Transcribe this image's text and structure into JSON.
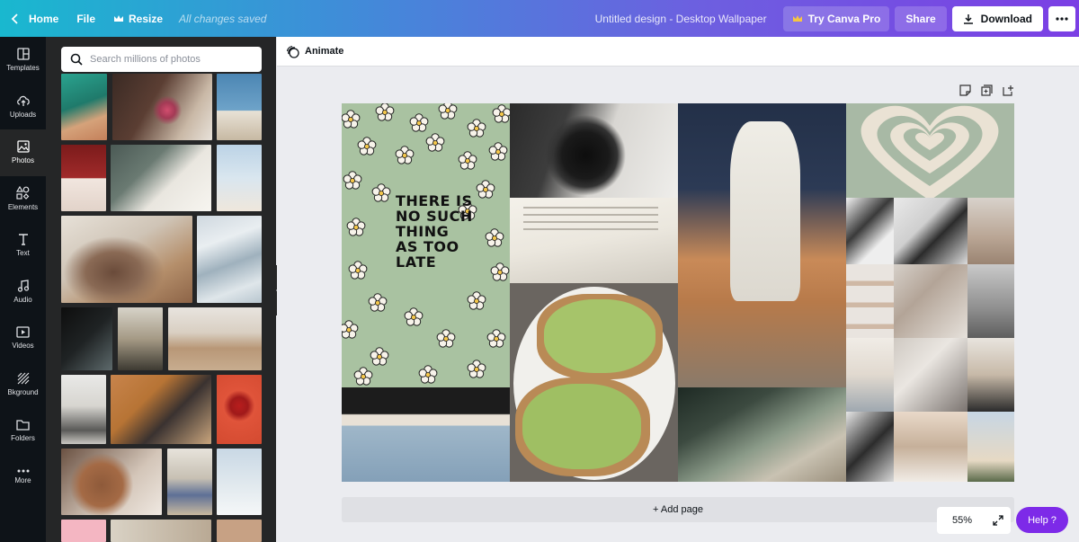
{
  "topbar": {
    "home_label": "Home",
    "file_label": "File",
    "resize_label": "Resize",
    "saved_status": "All changes saved",
    "design_title": "Untitled design - Desktop Wallpaper",
    "pro_label": "Try Canva Pro",
    "share_label": "Share",
    "download_label": "Download"
  },
  "rail": {
    "items": [
      {
        "label": "Templates",
        "icon": "templates-icon"
      },
      {
        "label": "Uploads",
        "icon": "upload-icon"
      },
      {
        "label": "Photos",
        "icon": "photo-icon"
      },
      {
        "label": "Elements",
        "icon": "elements-icon"
      },
      {
        "label": "Text",
        "icon": "text-icon"
      },
      {
        "label": "Audio",
        "icon": "audio-icon"
      },
      {
        "label": "Videos",
        "icon": "video-icon"
      },
      {
        "label": "Bkground",
        "icon": "background-icon"
      },
      {
        "label": "Folders",
        "icon": "folder-icon"
      },
      {
        "label": "More",
        "icon": "more-icon"
      }
    ],
    "active": "Photos"
  },
  "panel": {
    "search_placeholder": "Search millions of photos"
  },
  "editor": {
    "animate_label": "Animate",
    "add_page_label": "+ Add page",
    "zoom_label": "55%",
    "help_label": "Help ?",
    "quote_text": "THERE IS NO SUCH THING AS TOO LATE"
  },
  "colors": {
    "accent": "#7d2ae8",
    "rail_bg": "#0e1318",
    "panel_bg": "#252627",
    "quote_bg": "#a9c2a1"
  }
}
